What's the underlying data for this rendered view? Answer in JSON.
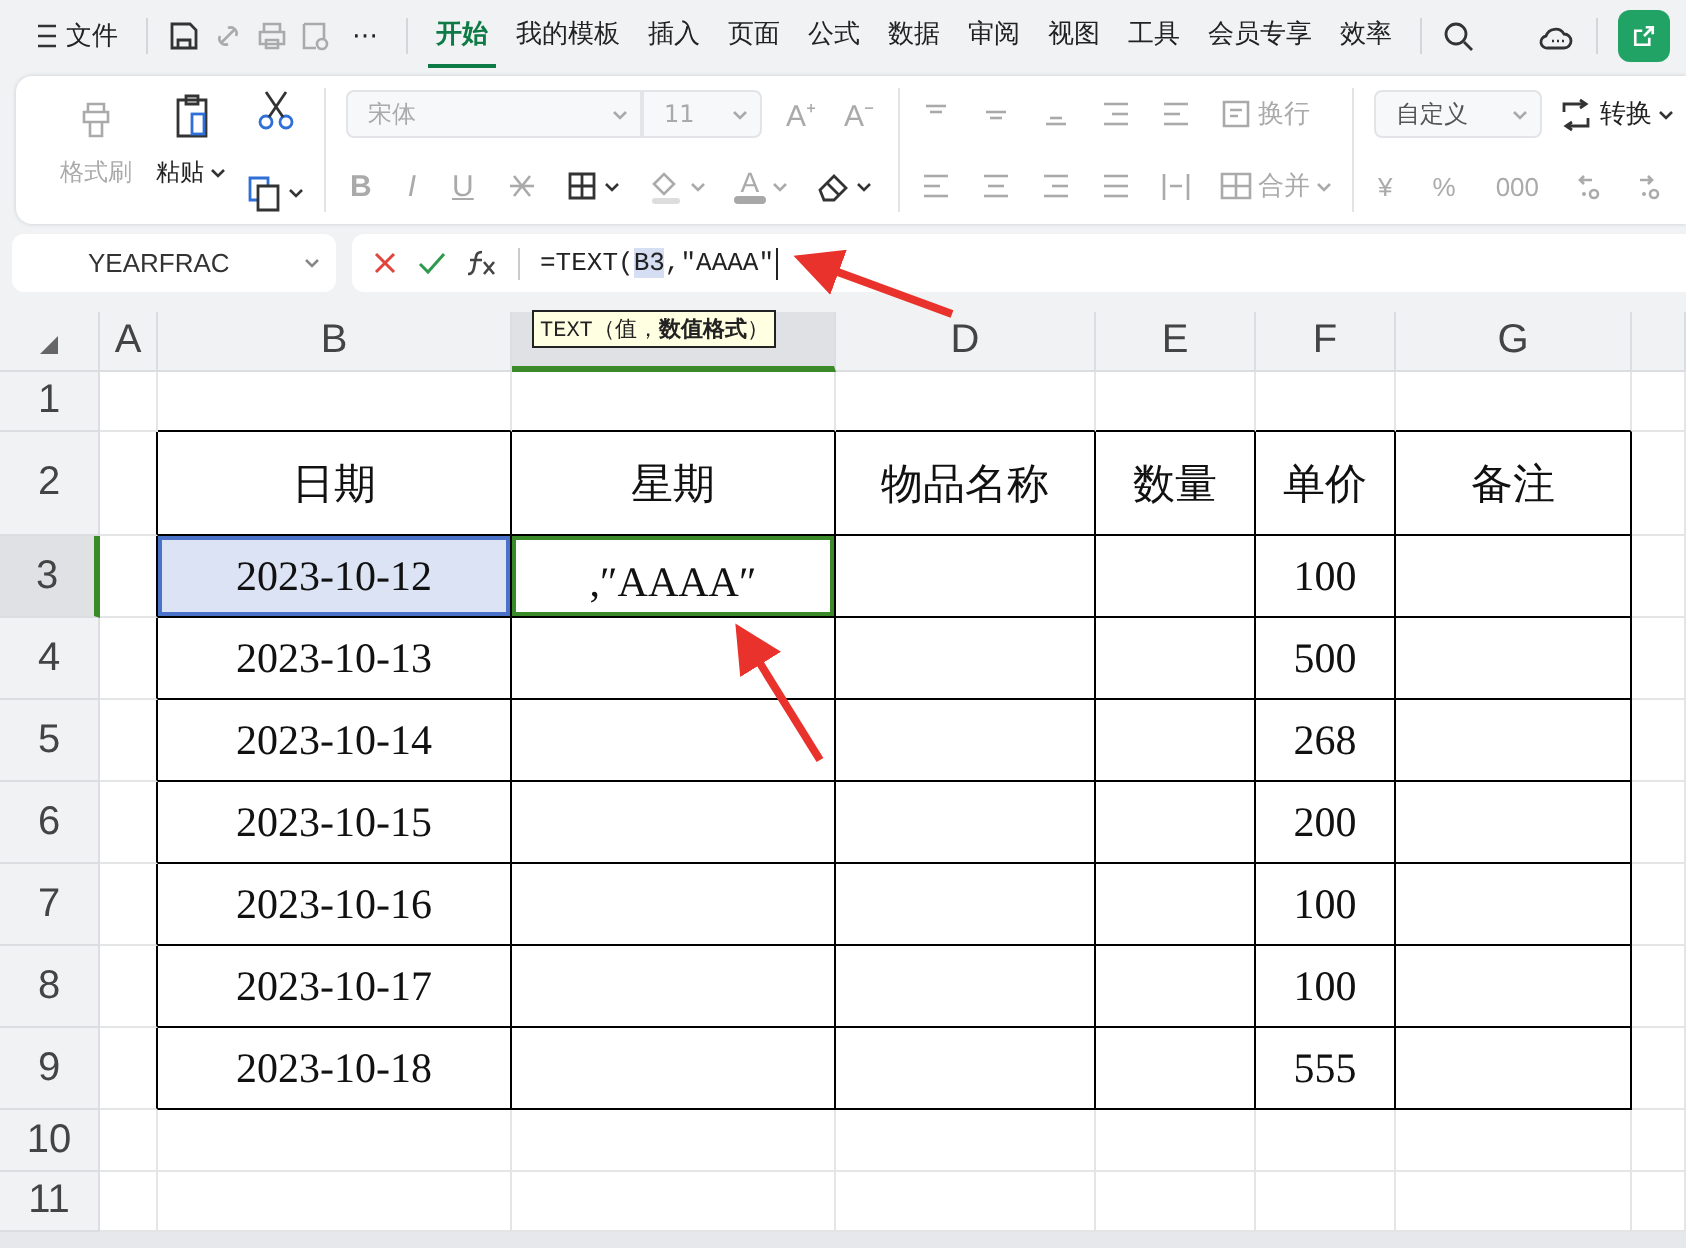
{
  "menu_bar": {
    "file": "文件",
    "more": "⋯",
    "tabs": [
      {
        "label": "开始",
        "selected": true
      },
      {
        "label": "我的模板",
        "selected": false
      },
      {
        "label": "插入",
        "selected": false
      },
      {
        "label": "页面",
        "selected": false
      },
      {
        "label": "公式",
        "selected": false
      },
      {
        "label": "数据",
        "selected": false
      },
      {
        "label": "审阅",
        "selected": false
      },
      {
        "label": "视图",
        "selected": false
      },
      {
        "label": "工具",
        "selected": false
      },
      {
        "label": "会员专享",
        "selected": false
      },
      {
        "label": "效率",
        "selected": false
      }
    ]
  },
  "ribbon": {
    "format_painter": {
      "label": "格式刷",
      "disabled": true
    },
    "paste": {
      "label": "粘贴",
      "disabled": false
    },
    "font": {
      "placeholder": "宋体"
    },
    "font_size": {
      "placeholder": "11"
    },
    "size_buttons": [
      "A⁺",
      "A⁻"
    ],
    "style_buttons": [
      "B",
      "I",
      "U"
    ],
    "font_color": {
      "glyph": "A",
      "color": "#a8a8a8"
    },
    "wrap": {
      "label": "换行",
      "disabled": true
    },
    "merge": {
      "label": "合并",
      "disabled": true
    },
    "number_format": {
      "value": "自定义"
    },
    "convert": {
      "label": "转换",
      "disabled": false
    },
    "number_buttons": [
      "¥",
      "%",
      "000"
    ]
  },
  "formula_bar": {
    "name_box": "YEARFRAC",
    "parts": [
      {
        "text": "=TEXT(",
        "ref": false
      },
      {
        "text": "B3",
        "ref": true
      },
      {
        "text": ",″AAAA″",
        "ref": false
      }
    ],
    "tooltip": "TEXT（值，**数值格式**）"
  },
  "sheet": {
    "columns": [
      {
        "label": "A",
        "selected": false
      },
      {
        "label": "B",
        "selected": false
      },
      {
        "selected": true
      },
      {
        "label": "D",
        "selected": false
      },
      {
        "label": "E",
        "selected": false
      },
      {
        "label": "F",
        "selected": false
      },
      {
        "label": "G",
        "selected": false
      }
    ],
    "rows": [
      {
        "label": "1",
        "selected": false,
        "cells": [
          {
            "text": "",
            "selected": false
          },
          {
            "text": "",
            "selected": false
          },
          {
            "text": "",
            "selected": false
          },
          {
            "text": "",
            "selected": false
          },
          {
            "text": "",
            "selected": false
          },
          {
            "text": "",
            "selected": false
          },
          {
            "text": "",
            "selected": false
          }
        ]
      },
      {
        "label": "2",
        "selected": false,
        "cells": [
          {
            "text": "",
            "selected": false
          },
          {
            "text": "日期",
            "selected": false
          },
          {
            "text": "星期",
            "selected": false
          },
          {
            "text": "物品名称",
            "selected": false
          },
          {
            "text": "数量",
            "selected": false
          },
          {
            "text": "单价",
            "selected": false
          },
          {
            "text": "备注",
            "selected": false
          }
        ]
      },
      {
        "label": "3",
        "selected": true,
        "cells": [
          {
            "text": "",
            "selected": false
          },
          {
            "text": "2023-10-12",
            "selected": true
          },
          {
            "text": ",″AAAA″",
            "editing": true,
            "selected": false
          },
          {
            "text": "",
            "selected": false
          },
          {
            "text": "",
            "selected": false
          },
          {
            "text": "100",
            "selected": false
          },
          {
            "text": "",
            "selected": false
          }
        ]
      },
      {
        "label": "4",
        "selected": false,
        "cells": [
          {
            "text": "",
            "selected": false
          },
          {
            "text": "2023-10-13",
            "selected": false
          },
          {
            "text": "",
            "selected": false
          },
          {
            "text": "",
            "selected": false
          },
          {
            "text": "",
            "selected": false
          },
          {
            "text": "500",
            "selected": false
          },
          {
            "text": "",
            "selected": false
          }
        ]
      },
      {
        "label": "5",
        "selected": false,
        "cells": [
          {
            "text": "",
            "selected": false
          },
          {
            "text": "2023-10-14",
            "selected": false
          },
          {
            "text": "",
            "selected": false
          },
          {
            "text": "",
            "selected": false
          },
          {
            "text": "",
            "selected": false
          },
          {
            "text": "268",
            "selected": false
          },
          {
            "text": "",
            "selected": false
          }
        ]
      },
      {
        "label": "6",
        "selected": false,
        "cells": [
          {
            "text": "",
            "selected": false
          },
          {
            "text": "2023-10-15",
            "selected": false
          },
          {
            "text": "",
            "selected": false
          },
          {
            "text": "",
            "selected": false
          },
          {
            "text": "",
            "selected": false
          },
          {
            "text": "200",
            "selected": false
          },
          {
            "text": "",
            "selected": false
          }
        ]
      },
      {
        "label": "7",
        "selected": false,
        "cells": [
          {
            "text": "",
            "selected": false
          },
          {
            "text": "2023-10-16",
            "selected": false
          },
          {
            "text": "",
            "selected": false
          },
          {
            "text": "",
            "selected": false
          },
          {
            "text": "",
            "selected": false
          },
          {
            "text": "100",
            "selected": false
          },
          {
            "text": "",
            "selected": false
          }
        ]
      },
      {
        "label": "8",
        "selected": false,
        "cells": [
          {
            "text": "",
            "selected": false
          },
          {
            "text": "2023-10-17",
            "selected": false
          },
          {
            "text": "",
            "selected": false
          },
          {
            "text": "",
            "selected": false
          },
          {
            "text": "",
            "selected": false
          },
          {
            "text": "100",
            "selected": false
          },
          {
            "text": "",
            "selected": false
          }
        ]
      },
      {
        "label": "9",
        "selected": false,
        "cells": [
          {
            "text": "",
            "selected": false
          },
          {
            "text": "2023-10-18",
            "selected": false
          },
          {
            "text": "",
            "selected": false
          },
          {
            "text": "",
            "selected": false
          },
          {
            "text": "",
            "selected": false
          },
          {
            "text": "555",
            "selected": false
          },
          {
            "text": "",
            "selected": false
          }
        ]
      },
      {
        "label": "10",
        "selected": false,
        "cells": [
          {
            "text": "",
            "selected": false
          },
          {
            "text": "",
            "selected": false
          },
          {
            "text": "",
            "selected": false
          },
          {
            "text": "",
            "selected": false
          },
          {
            "text": "",
            "selected": false
          },
          {
            "text": "",
            "selected": false
          },
          {
            "text": "",
            "selected": false
          }
        ]
      },
      {
        "label": "11",
        "selected": false,
        "cells": [
          {
            "text": "",
            "selected": false
          },
          {
            "text": "",
            "selected": false
          },
          {
            "text": "",
            "selected": false
          },
          {
            "text": "",
            "selected": false
          },
          {
            "text": "",
            "selected": false
          },
          {
            "text": "",
            "selected": false
          },
          {
            "text": "",
            "selected": false
          }
        ]
      }
    ]
  }
}
